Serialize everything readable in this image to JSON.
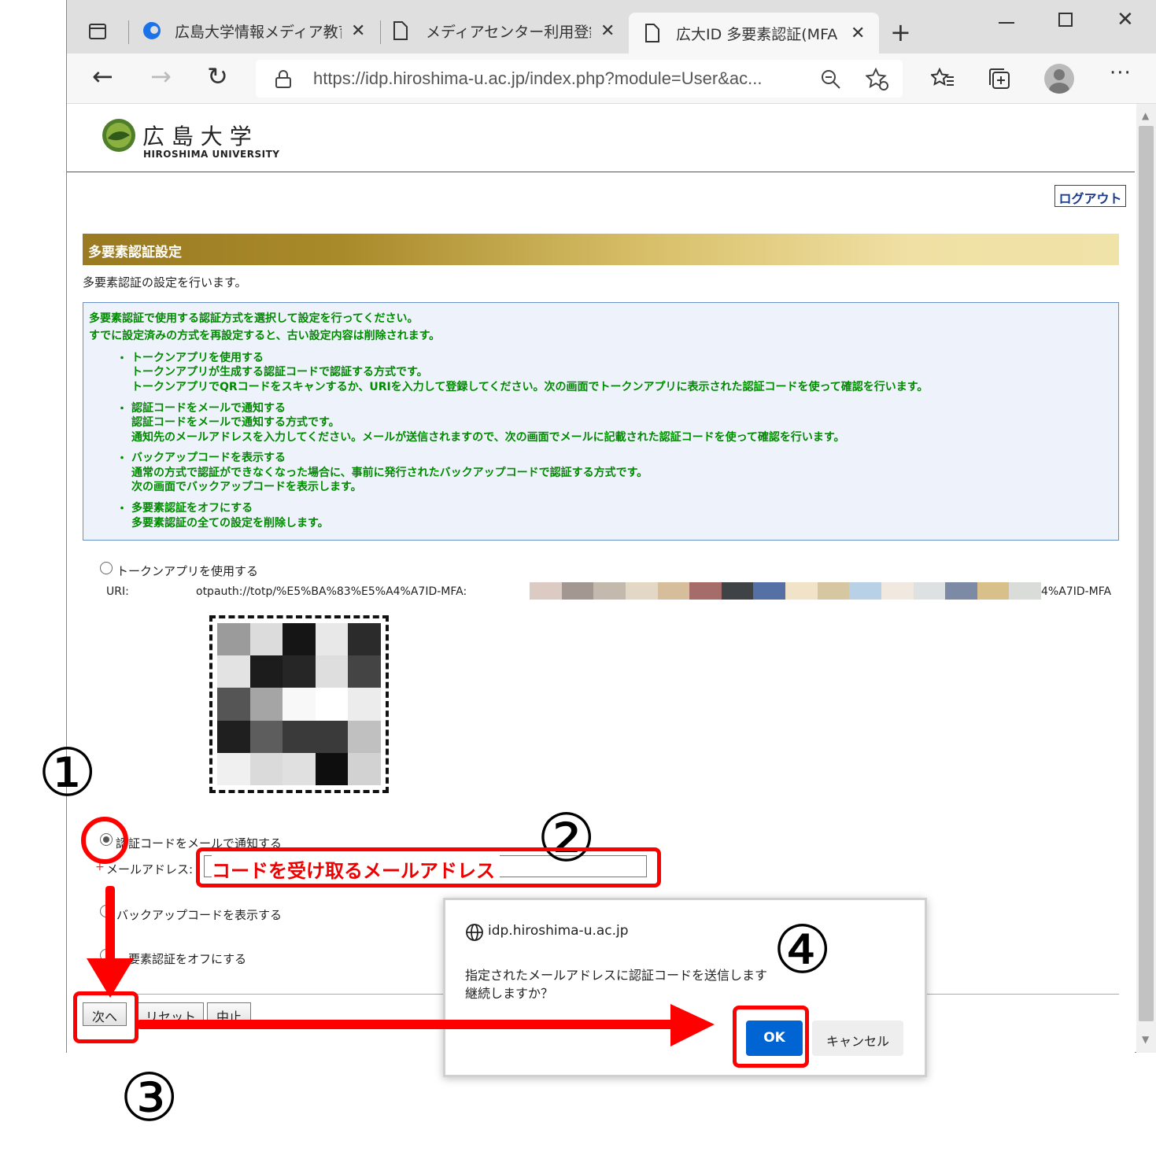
{
  "browser": {
    "tabs": [
      {
        "label": "広島大学情報メディア教育"
      },
      {
        "label": "メディアセンター利用登録シ"
      },
      {
        "label": "広大ID 多要素認証(MFA"
      }
    ],
    "url": "https://idp.hiroshima-u.ac.jp/index.php?module=User&ac..."
  },
  "header": {
    "univ_jp": "広 島 大 学",
    "univ_en": "HIROSHIMA UNIVERSITY",
    "logout": "ログアウト"
  },
  "section": {
    "title": "多要素認証設定",
    "desc": "多要素認証の設定を行います。",
    "info": {
      "intro1": "多要素認証で使用する認証方式を選択して設定を行ってください。",
      "intro2": "すでに設定済みの方式を再設定すると、古い設定内容は削除されます。",
      "items": [
        {
          "title": "トークンアプリを使用する",
          "l1": "トークンアプリが生成する認証コードで認証する方式です。",
          "l2": "トークンアプリでQRコードをスキャンするか、URIを入力して登録してください。次の画面でトークンアプリに表示された認証コードを使って確認を行います。"
        },
        {
          "title": "認証コードをメールで通知する",
          "l1": "認証コードをメールで通知する方式です。",
          "l2": "通知先のメールアドレスを入力してください。メールが送信されますので、次の画面でメールに記載された認証コードを使って確認を行います。"
        },
        {
          "title": "バックアップコードを表示する",
          "l1": "通常の方式で認証ができなくなった場合に、事前に発行されたバックアップコードで認証する方式です。",
          "l2": "次の画面でバックアップコードを表示します。"
        },
        {
          "title": "多要素認証をオフにする",
          "l1": "多要素認証の全ての設定を削除します。"
        }
      ]
    }
  },
  "form": {
    "token_label": "トークンアプリを使用する",
    "uri_label": "URI:",
    "uri_value": "otpauth://totp/%E5%BA%83%E5%A4%A7ID-MFA:",
    "uri_tail": "4%A7ID-MFA",
    "email_option": "証コードをメールで通知する",
    "email_option_prefix": "認",
    "email_label": "メールアドレス:",
    "email_required": "+",
    "email_value": "コードを受け取るメールアドレス",
    "backup_option": "バックアップコードを表示する",
    "off_option": "要素認証をオフにする",
    "buttons": {
      "next": "次へ",
      "reset": "リセット",
      "cancel": "中止"
    }
  },
  "dialog": {
    "origin": "idp.hiroshima-u.ac.jp",
    "line1": "指定されたメールアドレスに認証コードを送信します",
    "line2": "継続しますか？",
    "ok": "OK",
    "cancel": "キャンセル"
  },
  "annotations": {
    "step1": "①",
    "step2": "②",
    "step3": "③",
    "step4": "④"
  },
  "colors": {
    "annotation": "#ff0000",
    "header_gold": "#a98a2a",
    "info_text": "#008a00",
    "ok_button": "#0064d2"
  }
}
